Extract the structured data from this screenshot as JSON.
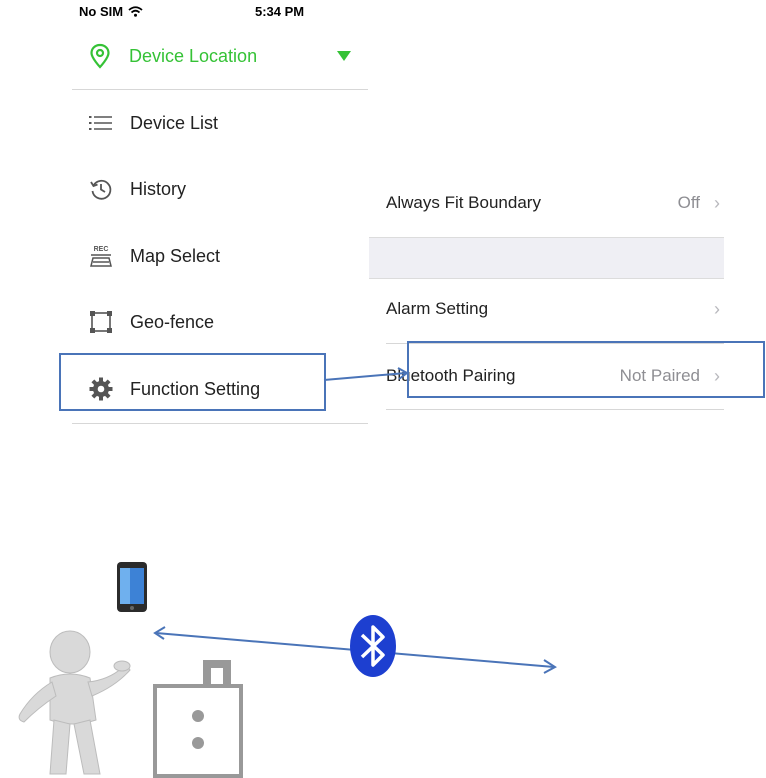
{
  "status_bar": {
    "carrier": "No SIM",
    "time": "5:34 PM"
  },
  "menu": {
    "header": {
      "label": "Device Location",
      "icon": "location-pin-icon",
      "color": "#35c236"
    },
    "items": [
      {
        "label": "Device List",
        "icon": "list-icon"
      },
      {
        "label": "History",
        "icon": "history-icon"
      },
      {
        "label": "Map Select",
        "icon": "rec-icon",
        "icon_text": "REC"
      },
      {
        "label": "Geo-fence",
        "icon": "geofence-icon"
      },
      {
        "label": "Function Setting",
        "icon": "gear-icon"
      }
    ]
  },
  "settings": {
    "rows": [
      {
        "label": "Always Fit Boundary",
        "value": "Off"
      },
      {
        "label": "Alarm Setting",
        "value": ""
      },
      {
        "label": "Bluetooth Pairing",
        "value": "Not Paired"
      }
    ]
  },
  "illustration": {
    "icons": [
      "smartphone-icon",
      "person-figure",
      "device-tag-icon",
      "bluetooth-icon"
    ],
    "highlight_color": "#4a74b8",
    "bluetooth_color": "#1d3fd0"
  }
}
